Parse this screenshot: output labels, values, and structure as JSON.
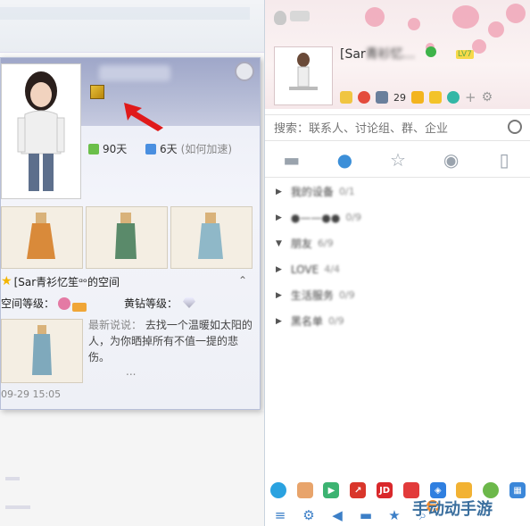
{
  "profile_card": {
    "stat_days_value": "90天",
    "stat_weeks_value": "6天",
    "stat_weeks_hint": "(如何加速)",
    "zone_title": "[Sar青衫忆笙ᵅᵒ的空间",
    "space_level_label": "空间等级：",
    "vip_level_label": "黄钻等级：",
    "latest_label": "最新说说：",
    "latest_text": "去找一个温暖如太阳的人，为你晒掉所有不值一提的悲伤。",
    "latest_more": "...",
    "timestamp": "09-29 15:05"
  },
  "qq_panel": {
    "name_prefix": "[Sar",
    "name_suffix": "青衫忆...",
    "level_badge": "LV7",
    "mail_count": "29",
    "search_placeholder": "搜索：联系人、讨论组、群、企业",
    "groups": [
      {
        "name": "我的设备",
        "count": "0/1",
        "expanded": false
      },
      {
        "name": "●——●●",
        "count": "0/9",
        "expanded": false
      },
      {
        "name": "朋友",
        "count": "6/9",
        "expanded": true
      },
      {
        "name": "LOVE",
        "count": "4/4",
        "expanded": false
      },
      {
        "name": "生活服务",
        "count": "0/9",
        "expanded": false
      },
      {
        "name": "黑名单",
        "count": "0/9",
        "expanded": false
      }
    ],
    "app_labels": [
      "JD"
    ],
    "watermark": "手动动手游"
  },
  "colors": {
    "accent_blue": "#3c8fd8",
    "arrow_red": "#e01a1a",
    "blossom_pink": "#ef9cb0"
  }
}
